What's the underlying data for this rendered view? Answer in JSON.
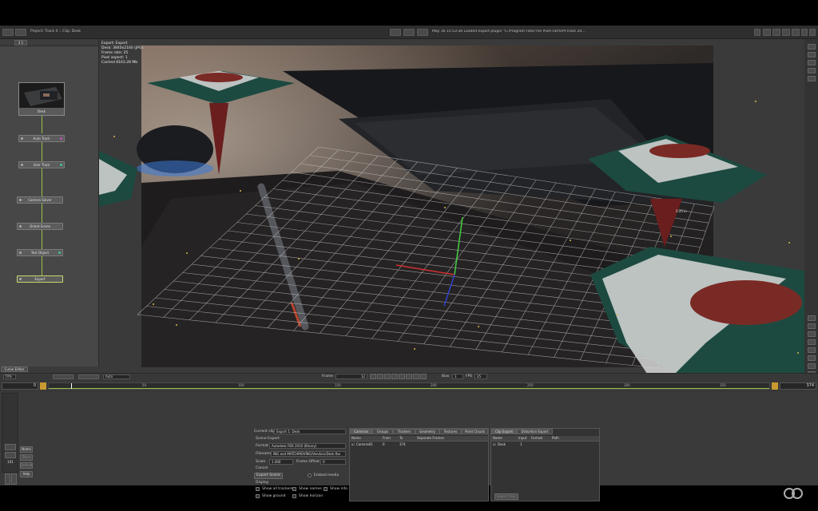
{
  "topbar": {
    "project_title": "Project: Track 4 :: Clip: Desk",
    "status_text": "May 16 15:53:36 Loaded export plugin \"C:/Program Files/The Pixel Farm/PFTrack 20...",
    "tab_label": "3 1"
  },
  "viewport_overlay": {
    "line1": "Export: Export",
    "line2": "Desk: 3840x2160 (JPG)",
    "line3": "Frame rate: 25",
    "line4": "Pixel aspect: 1",
    "line5": "Cached 8163.28 Mb",
    "measure_label": "0.25 in"
  },
  "nodes": [
    {
      "label": "Desk",
      "color": "#c0c0c0"
    },
    {
      "label": "Auto Track",
      "color": "#c050c0"
    },
    {
      "label": "User Track",
      "color": "#40c0a0"
    },
    {
      "label": "Camera Solver",
      "color": ""
    },
    {
      "label": "Orient Scene",
      "color": ""
    },
    {
      "label": "Test Object",
      "color": "#40c0a0"
    },
    {
      "label": "Export",
      "color": ""
    }
  ],
  "left_footer": {
    "curve_editor": "Curve Editor",
    "zoom": "70%",
    "auto": "Auto"
  },
  "playback": {
    "frame_label": "Frame",
    "frame_value": "12",
    "step_value": "1",
    "fps_label": "FPS",
    "fps_value": "25",
    "bias_label": "Bias"
  },
  "timeline": {
    "start": "0",
    "end": "374",
    "ticks": [
      "50",
      "100",
      "150",
      "200",
      "250",
      "300",
      "350"
    ]
  },
  "side_buttons": {
    "notes": "Notes",
    "store": "Store",
    "default": "Default",
    "help": "Help",
    "counter": "101"
  },
  "export_panel": {
    "current_clip_label": "Current clip",
    "current_clip_value": "Export 1: Desk",
    "scene_export_label": "Scene Export",
    "format_label": "Format",
    "format_value": "Autodesk FBX 2010 (Binary)",
    "filename_label": "Filename",
    "filename_value": "ING and MATCHMOVING/Vendors/Desk.fbx",
    "scale_label": "Scale",
    "scale_value": "1.000",
    "frame_offset_label": "Frame Offset",
    "frame_offset_value": "0",
    "cancel_label": "Cancel",
    "export_scene_button": "Export Scene",
    "embed_media_label": "Embed media",
    "display_label": "Display",
    "show_all_trackers": "Show all trackers",
    "show_names": "Show names",
    "show_info": "Show info",
    "show_ground": "Show ground",
    "show_horizon": "Show horizon"
  },
  "cameras_panel": {
    "tabs": [
      "Cameras",
      "Groups",
      "Trackers",
      "Geometry",
      "Textures",
      "Point Clouds"
    ],
    "headers": [
      "Name",
      "From",
      "To",
      "Separate Frames"
    ],
    "rows": [
      {
        "name": "Camera01",
        "from": "0",
        "to": "374",
        "separate": ""
      }
    ]
  },
  "clip_export_panel": {
    "tabs": [
      "Clip Export",
      "Distortion Export"
    ],
    "headers": [
      "Name",
      "Input",
      "Format",
      "Path"
    ],
    "rows": [
      {
        "name": "Desk",
        "input": "1",
        "format": "",
        "path": ""
      }
    ],
    "export_clips_button": "Export Clips"
  }
}
